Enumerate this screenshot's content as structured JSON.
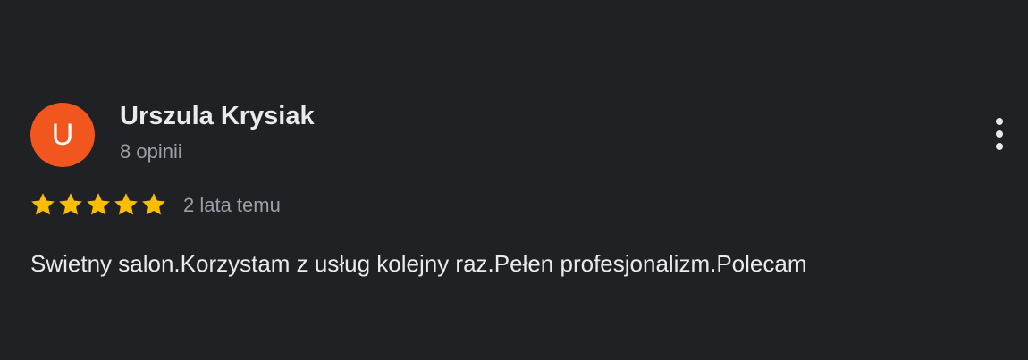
{
  "review": {
    "author": {
      "initial": "U",
      "name": "Urszula Krysiak",
      "review_count": "8 opinii",
      "avatar_color": "#f0561d"
    },
    "rating": {
      "stars": 5,
      "max": 5,
      "star_color": "#fbbc04"
    },
    "date": "2 lata temu",
    "text": "Swietny salon.Korzystam z usług kolejny raz.Pełen profesjonalizm.Polecam",
    "menu_icon": "more-vert-icon"
  },
  "colors": {
    "background": "#202124",
    "primary_text": "#e8eaed",
    "secondary_text": "#9aa0a6"
  }
}
